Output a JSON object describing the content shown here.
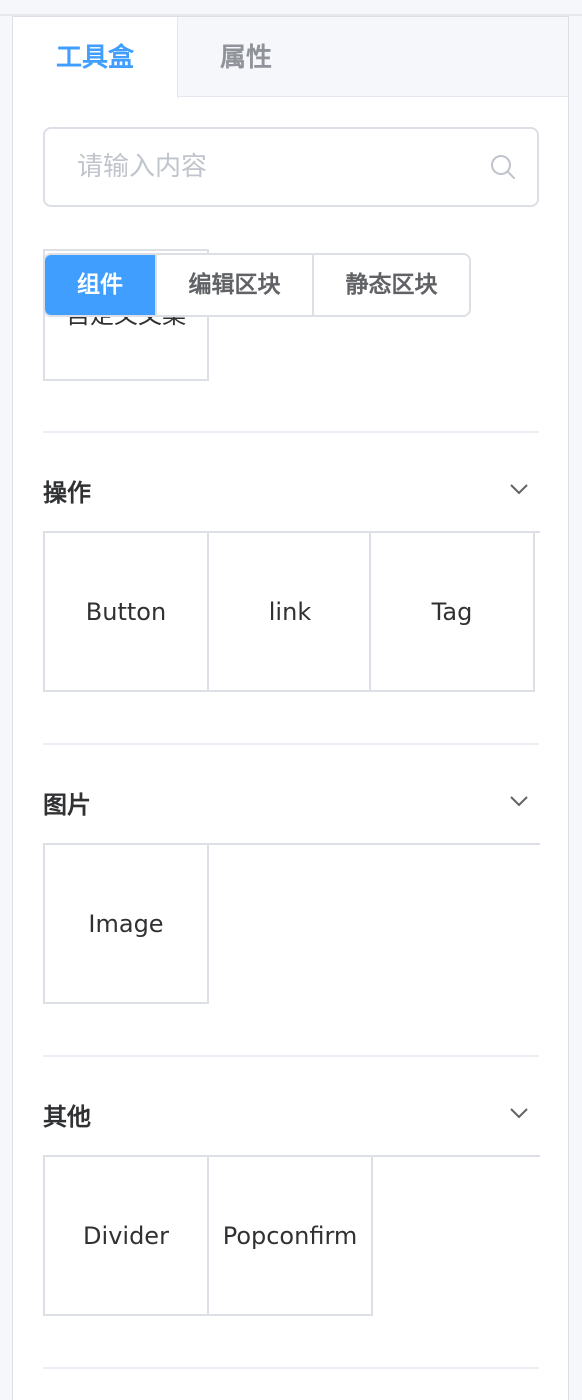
{
  "tabs": [
    {
      "label": "工具盒",
      "active": true
    },
    {
      "label": "属性",
      "active": false
    }
  ],
  "search": {
    "placeholder": "请输入内容",
    "value": ""
  },
  "segments": [
    {
      "label": "组件",
      "active": true
    },
    {
      "label": "编辑区块",
      "active": false
    },
    {
      "label": "静态区块",
      "active": false
    }
  ],
  "partial_item": {
    "label": "自定义文案"
  },
  "sections": [
    {
      "title": "操作",
      "items": [
        "Button",
        "link",
        "Tag"
      ]
    },
    {
      "title": "图片",
      "items": [
        "Image"
      ]
    },
    {
      "title": "其他",
      "items": [
        "Divider",
        "Popconfirm"
      ]
    }
  ],
  "colors": {
    "accent": "#409eff",
    "border": "#dcdfe6",
    "muted": "#909399"
  },
  "icons": {
    "search": "search-icon",
    "section_toggle": "chevron-down-icon"
  }
}
